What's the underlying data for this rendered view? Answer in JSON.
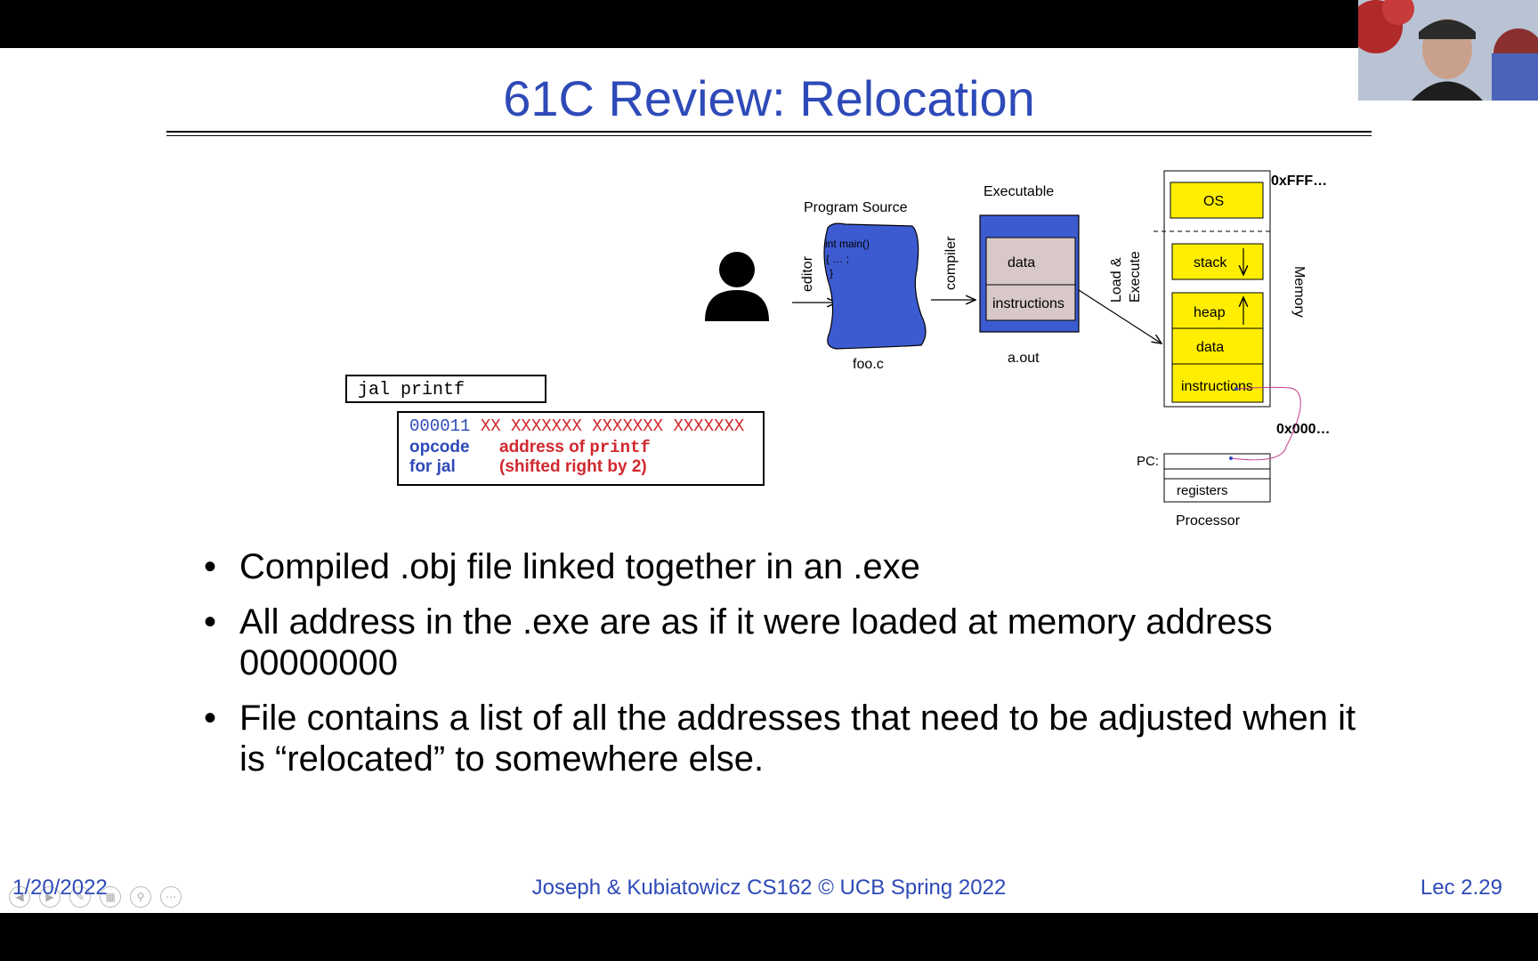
{
  "slide": {
    "title": "61C Review: Relocation",
    "bullets": [
      "Compiled .obj file linked together in an .exe",
      "All address in the .exe are as if it were loaded at memory address 00000000",
      "File contains a list of all the addresses that need to be adjusted when it is “relocated” to somewhere else."
    ],
    "footer": {
      "date": "1/20/2022",
      "center": "Joseph & Kubiatowicz CS162 © UCB Spring 2022",
      "right": "Lec 2.29"
    }
  },
  "diagram": {
    "jal_instruction": "jal printf",
    "encoding": {
      "opcode_bits": "000011",
      "address_bits": "XX XXXXXXX XXXXXXX XXXXXXX",
      "opcode_label_1": "opcode",
      "opcode_label_2": "for jal",
      "address_label_1": "address of ",
      "address_label_mono": "printf",
      "address_label_2": "(shifted right by 2)"
    },
    "labels": {
      "program_source": "Program Source",
      "editor": "editor",
      "compiler": "compiler",
      "executable": "Executable",
      "load_execute_1": "Load &",
      "load_execute_2": "Execute",
      "source_code_1": "int main()",
      "source_code_2": "{ … ;",
      "source_code_3": "}",
      "foo_c": "foo.c",
      "a_out": "a.out",
      "exe_data": "data",
      "exe_instructions": "instructions",
      "memory": "Memory",
      "os": "OS",
      "stack": "stack",
      "heap": "heap",
      "mem_data": "data",
      "mem_instructions": "instructions",
      "addr_high": "0xFFF…",
      "addr_low": "0x000…",
      "pc": "PC:",
      "registers": "registers",
      "processor": "Processor"
    },
    "colors": {
      "title_blue": "#2e4ab8",
      "source_blue": "#3d5bd0",
      "memory_yellow": "#ffee00",
      "exe_box_bg": "#d9c8c8",
      "red": "#d1282e"
    }
  }
}
